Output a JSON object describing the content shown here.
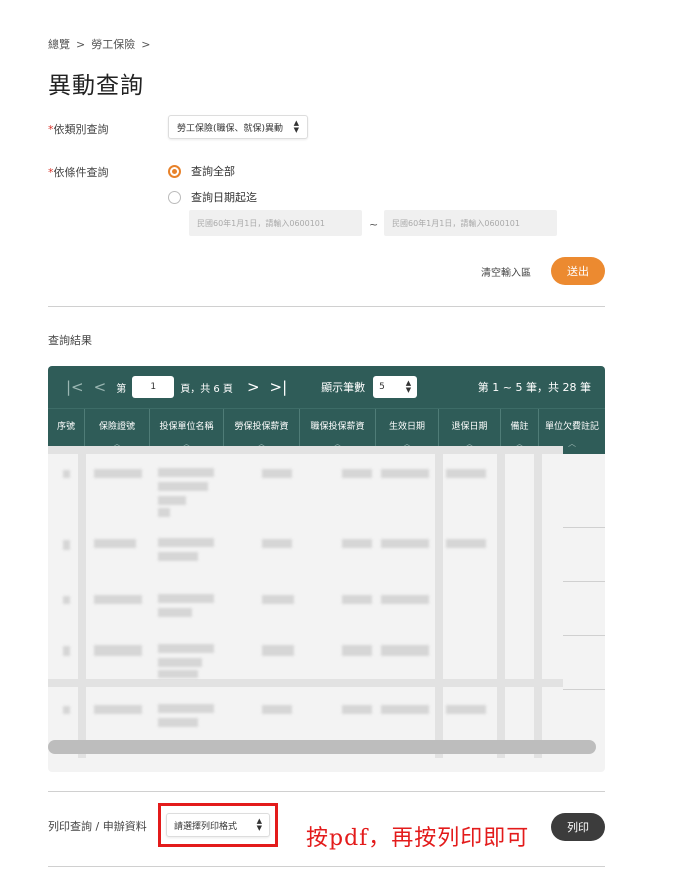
{
  "breadcrumb": [
    "總覽",
    "勞工保險"
  ],
  "breadcrumb_separator": ">",
  "page_title": "異動查詢",
  "filters": {
    "category_label": "依類別查詢",
    "category_value": "勞工保險(職保、就保)異動",
    "condition_label": "依條件查詢",
    "radio_all": "查詢全部",
    "radio_all_checked": true,
    "radio_date": "查詢日期起迄",
    "date_from_placeholder": "民國60年1月1日，請輸入0600101",
    "date_to_placeholder": "民國60年1月1日，請輸入0600101",
    "date_sep": "~",
    "clear_label": "清空輸入區",
    "submit_label": "送出"
  },
  "results": {
    "section_title": "查詢結果",
    "page_prefix": "第",
    "current_page": "1",
    "page_suffix": "頁，共 6 頁",
    "per_page_label": "顯示筆數",
    "per_page_value": "5",
    "range_text": "第 1 ~ 5 筆，共 28 筆",
    "columns": [
      "序號",
      "保險證號",
      "投保單位名稱",
      "勞保投保薪資",
      "職保投保薪資",
      "生效日期",
      "退保日期",
      "備註",
      "單位欠費註記"
    ]
  },
  "footer": {
    "print_label": "列印查詢 / 申辦資料",
    "print_format_value": "請選擇列印格式",
    "annotation": "按pdf，再按列印即可",
    "print_button": "列印"
  },
  "colors": {
    "accent_orange": "#ec8a30",
    "table_header": "#2f5c58",
    "annotation_red": "#e31b1b"
  }
}
